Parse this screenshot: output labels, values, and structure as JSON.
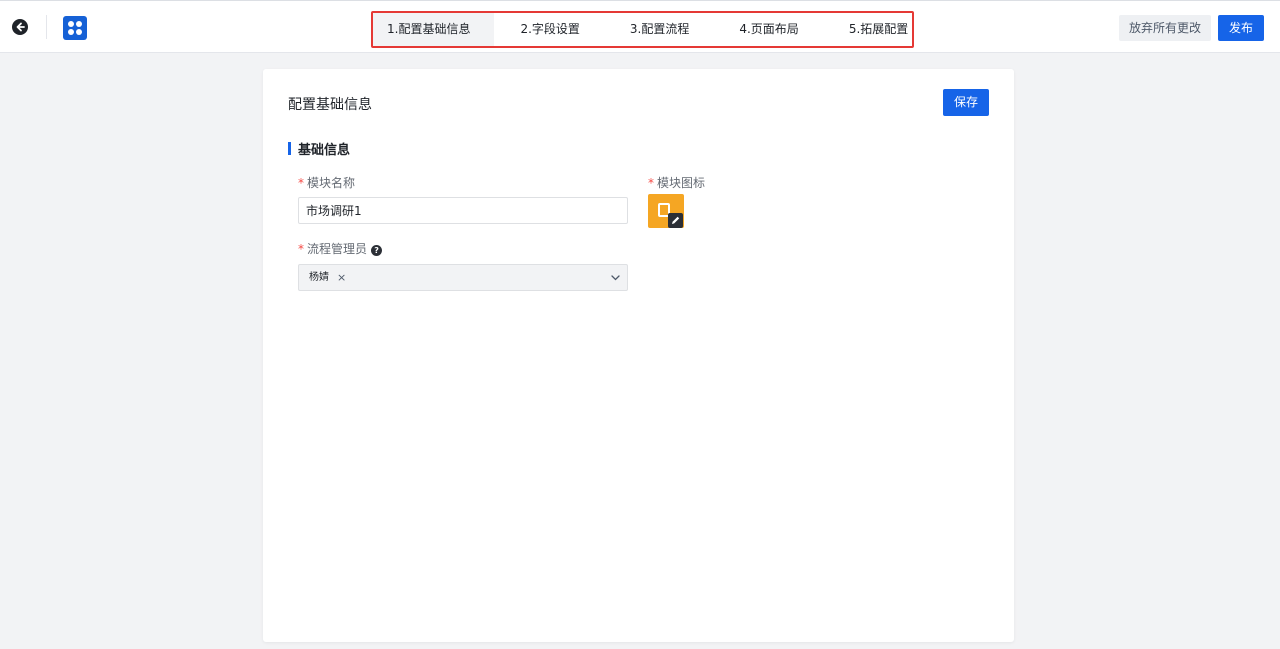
{
  "header": {
    "back_icon": "arrow-left-icon",
    "app_icon": "grid-apps-icon",
    "steps": [
      {
        "label": "1.配置基础信息",
        "active": true
      },
      {
        "label": "2.字段设置",
        "active": false
      },
      {
        "label": "3.配置流程",
        "active": false
      },
      {
        "label": "4.页面布局",
        "active": false
      },
      {
        "label": "5.拓展配置",
        "active": false
      }
    ],
    "discard_label": "放弃所有更改",
    "publish_label": "发布"
  },
  "main": {
    "title": "配置基础信息",
    "save_label": "保存",
    "section_title": "基础信息",
    "form": {
      "required_mark": "*",
      "module_name_label": "模块名称",
      "module_name_value": "市场调研1",
      "module_icon_label": "模块图标",
      "module_icon": "document-edit-icon",
      "admin_label": "流程管理员",
      "admin_help_icon": "?",
      "admin_tags": [
        "杨婧"
      ],
      "tag_close": "×"
    }
  },
  "colors": {
    "accent": "#1664e8",
    "required": "#f54a45",
    "icon_bg": "#f5a623",
    "highlight_border": "#e53935"
  }
}
